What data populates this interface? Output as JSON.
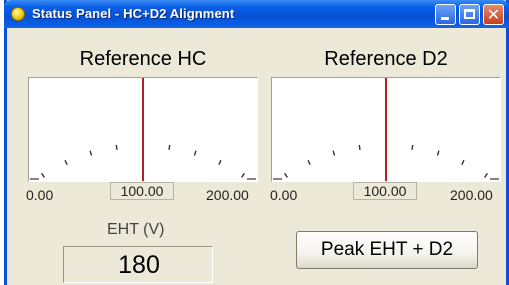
{
  "window": {
    "title": "Status Panel - HC+D2 Alignment"
  },
  "meters": [
    {
      "title": "Reference HC",
      "scale_min": "0.00",
      "scale_mid": "100.00",
      "scale_max": "200.00",
      "value": 100
    },
    {
      "title": "Reference D2",
      "scale_min": "0.00",
      "scale_mid": "100.00",
      "scale_max": "200.00",
      "value": 100
    }
  ],
  "eht": {
    "label": "EHT (V)",
    "value": "180"
  },
  "peak_button": {
    "label": "Peak EHT + D2"
  },
  "colors": {
    "needle": "#b22222",
    "titlebar": "#0a5fe6"
  }
}
